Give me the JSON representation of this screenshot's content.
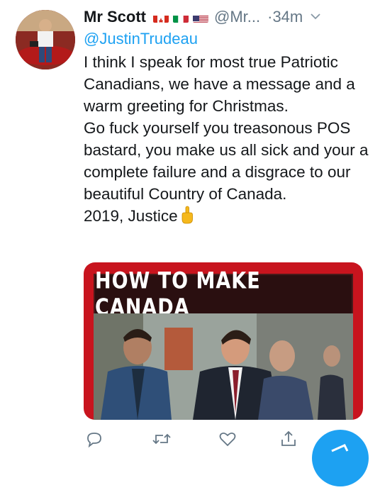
{
  "tweet": {
    "author_name": "Mr Scott",
    "author_flags": [
      "canada-flag-icon",
      "italy-flag-icon",
      "usa-flag-icon"
    ],
    "handle": "@Mr...",
    "separator": "·",
    "timestamp": "34m",
    "reply_to": "@JustinTrudeau",
    "lines": [
      "I think I speak for most true Patriotic Canadians, we have a message and a warm greeting for Christmas.",
      "Go fuck yourself you treasonous POS bastard, you make us all sick and your a complete failure and a disgrace to our beautiful Country of Canada.",
      "2019, Justice"
    ],
    "trailing_emoji": "middle-finger-emoji",
    "media": {
      "banner_text": "HOW TO MAKE CANADA"
    },
    "actions": [
      "reply-icon",
      "retweet-icon",
      "like-icon",
      "share-icon"
    ]
  },
  "colors": {
    "link": "#1da1f2",
    "secondary": "#657786",
    "banner_red": "#c8141e",
    "fab": "#1da1f2"
  }
}
